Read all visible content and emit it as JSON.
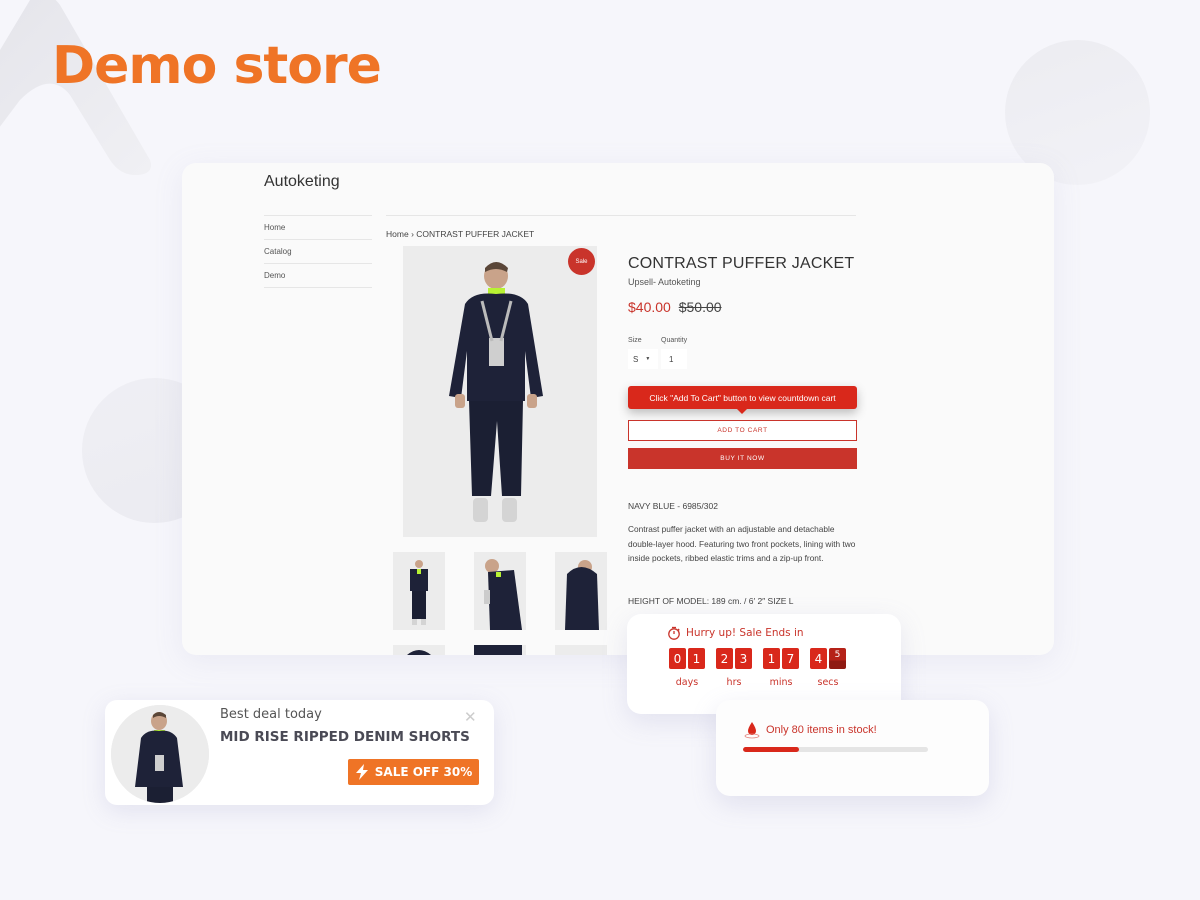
{
  "page": {
    "title": "Demo store"
  },
  "colors": {
    "brand_orange": "#ef7426",
    "accent_red": "#c9342b",
    "countdown_red": "#d9281b",
    "background": "#f6f6fb"
  },
  "store": {
    "brand": "Autoketing",
    "nav": [
      {
        "label": "Home"
      },
      {
        "label": "Catalog"
      },
      {
        "label": "Demo"
      }
    ],
    "breadcrumb": {
      "home": "Home",
      "separator": "›",
      "current": "CONTRAST PUFFER JACKET"
    },
    "product": {
      "sale_badge": "Sale",
      "title": "CONTRAST PUFFER JACKET",
      "vendor": "Upsell- Autoketing",
      "price": "$40.00",
      "compare_price": "$50.00",
      "size_label": "Size",
      "size_value": "S",
      "quantity_label": "Quantity",
      "quantity_value": "1",
      "tooltip": "Click \"Add To Cart\" button to view countdown cart",
      "add_to_cart": "ADD TO CART",
      "buy_now": "BUY IT NOW",
      "sku": "NAVY BLUE - 6985/302",
      "description": "Contrast puffer jacket with an adjustable and detachable double-layer hood. Featuring two front pockets, lining with two inside pockets, ribbed elastic trims and a zip-up front.",
      "model_height": "HEIGHT OF MODEL: 189 cm. / 6′ 2″ SIZE L",
      "thumbnails": [
        "front-view",
        "side-view-head-down",
        "back-view",
        "detail-1",
        "detail-2",
        "detail-3"
      ]
    }
  },
  "countdown": {
    "icon": "stopwatch-icon",
    "heading": "Hurry up! Sale Ends in",
    "groups": [
      {
        "unit": "days",
        "digits": [
          "0",
          "1"
        ]
      },
      {
        "unit": "hrs",
        "digits": [
          "2",
          "3"
        ]
      },
      {
        "unit": "mins",
        "digits": [
          "1",
          "7"
        ]
      },
      {
        "unit": "secs",
        "digits": [
          "4",
          "5"
        ]
      }
    ]
  },
  "stock": {
    "icon": "droplet-icon",
    "text": "Only 80 items in stock!",
    "fill_fraction": 0.3
  },
  "deal_popup": {
    "kicker": "Best deal today",
    "product": "MID RISE RIPPED DENIM SHORTS",
    "button_icon": "lightning-icon",
    "button": "SALE OFF 30%",
    "close_icon": "close-icon"
  }
}
